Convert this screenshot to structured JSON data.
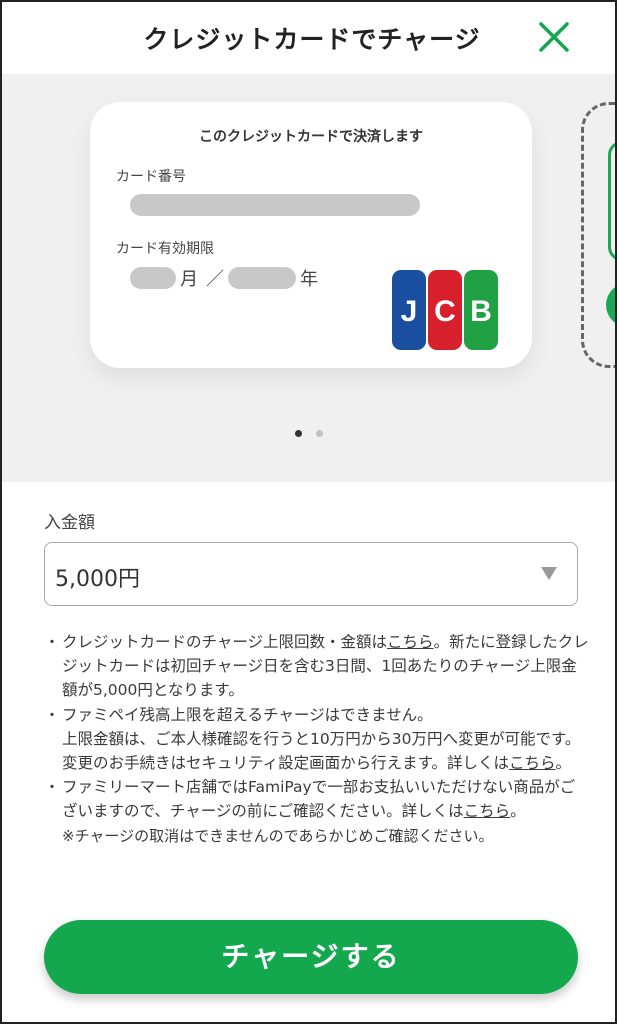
{
  "header": {
    "title": "クレジットカードでチャージ",
    "close_icon": "close-icon"
  },
  "card": {
    "heading": "このクレジットカードで決済します",
    "number_label": "カード番号",
    "expiry_label": "カード有効期限",
    "month_unit": "月",
    "separator": "／",
    "year_unit": "年",
    "brand_logo": "JCB"
  },
  "carousel": {
    "page_count": 2,
    "active_index": 0
  },
  "amount": {
    "label": "入金額",
    "value": "5,000円"
  },
  "notes": {
    "n1_a": "クレジットカードのチャージ上限回数・金額は",
    "n1_link": "こちら",
    "n1_b": "。新たに登録したクレジットカードは初回チャージ日を含む3日間、1回あたりのチャージ上限金額が5,000円となります。",
    "n2_a": "ファミペイ残高上限を超えるチャージはできません。",
    "n2_b": "上限金額は、ご本人様確認を行うと10万円から30万円へ変更が可能です。変更のお手続きはセキュリティ設定画面から行えます。詳しくは",
    "n2_link": "こちら",
    "n2_c": "。",
    "n3_a": "ファミリーマート店舗ではFamiPayで一部お支払いいただけない商品がございますので、チャージの前にご確認ください。詳しくは",
    "n3_link": "こちら",
    "n3_b": "。",
    "remark": "※チャージの取消はできませんのであらかじめご確認ください。",
    "bullet": "・"
  },
  "charge_button": {
    "label": "チャージする"
  },
  "colors": {
    "accent": "#13a84e",
    "mask": "#c8c8c8",
    "carousel_bg": "#f0f0f0"
  }
}
